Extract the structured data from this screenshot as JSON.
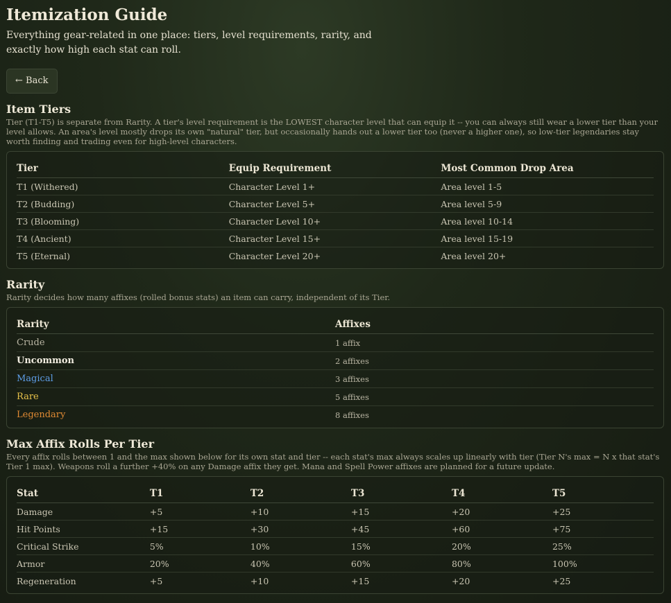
{
  "page": {
    "title": "Itemization Guide",
    "subtitle": "Everything gear-related in one place: tiers, level requirements, rarity, and exactly how high each stat can roll.",
    "back_label": "← Back"
  },
  "tiers": {
    "heading": "Item Tiers",
    "description": "Tier (T1-T5) is separate from Rarity. A tier's level requirement is the LOWEST character level that can equip it -- you can always still wear a lower tier than your level allows. An area's level mostly drops its own \"natural\" tier, but occasionally hands out a lower tier too (never a higher one), so low-tier legendaries stay worth finding and trading even for high-level characters.",
    "columns": [
      "Tier",
      "Equip Requirement",
      "Most Common Drop Area"
    ],
    "rows": [
      [
        "T1 (Withered)",
        "Character Level 1+",
        "Area level 1-5"
      ],
      [
        "T2 (Budding)",
        "Character Level 5+",
        "Area level 5-9"
      ],
      [
        "T3 (Blooming)",
        "Character Level 10+",
        "Area level 10-14"
      ],
      [
        "T4 (Ancient)",
        "Character Level 15+",
        "Area level 15-19"
      ],
      [
        "T5 (Eternal)",
        "Character Level 20+",
        "Area level 20+"
      ]
    ]
  },
  "rarity": {
    "heading": "Rarity",
    "description": "Rarity decides how many affixes (rolled bonus stats) an item can carry, independent of its Tier.",
    "columns": [
      "Rarity",
      "Affixes"
    ],
    "rows": [
      {
        "name": "Crude",
        "affixes": "1 affix",
        "color": "#b9b5a3",
        "bold": false
      },
      {
        "name": "Uncommon",
        "affixes": "2 affixes",
        "color": "#f1ece0",
        "bold": true
      },
      {
        "name": "Magical",
        "affixes": "3 affixes",
        "color": "#5f9ee8",
        "bold": false
      },
      {
        "name": "Rare",
        "affixes": "5 affixes",
        "color": "#e8c24a",
        "bold": false
      },
      {
        "name": "Legendary",
        "affixes": "8 affixes",
        "color": "#e08a33",
        "bold": false
      }
    ]
  },
  "affix": {
    "heading": "Max Affix Rolls Per Tier",
    "description": "Every affix rolls between 1 and the max shown below for its own stat and tier -- each stat's max always scales up linearly with tier (Tier N's max = N x that stat's Tier 1 max). Weapons roll a further +40% on any Damage affix they get. Mana and Spell Power affixes are planned for a future update.",
    "columns": [
      "Stat",
      "T1",
      "T2",
      "T3",
      "T4",
      "T5"
    ],
    "rows": [
      [
        "Damage",
        "+5",
        "+10",
        "+15",
        "+20",
        "+25"
      ],
      [
        "Hit Points",
        "+15",
        "+30",
        "+45",
        "+60",
        "+75"
      ],
      [
        "Critical Strike",
        "5%",
        "10%",
        "15%",
        "20%",
        "25%"
      ],
      [
        "Armor",
        "20%",
        "40%",
        "60%",
        "80%",
        "100%"
      ],
      [
        "Regeneration",
        "+5",
        "+10",
        "+15",
        "+20",
        "+25"
      ]
    ]
  }
}
